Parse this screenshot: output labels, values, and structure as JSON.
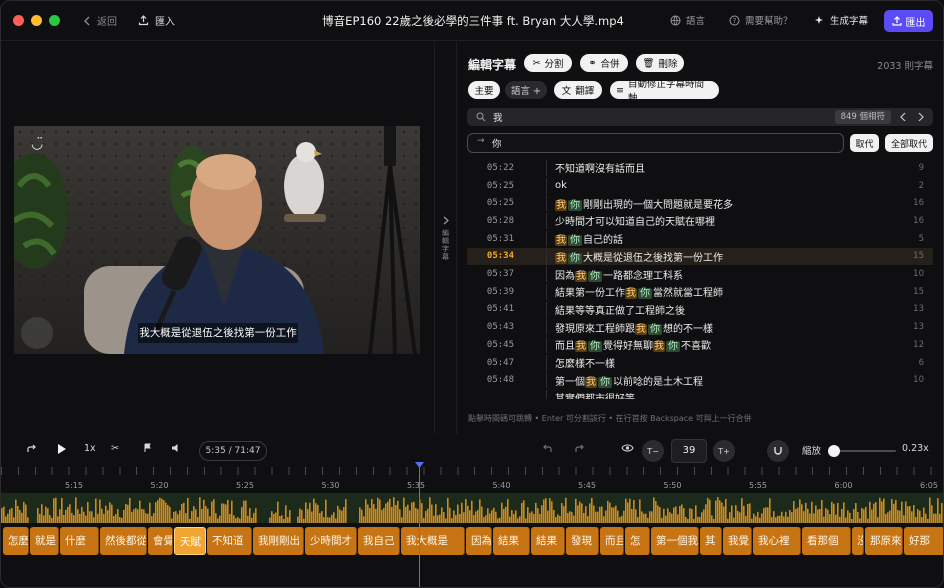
{
  "titlebar": {
    "back": "返回",
    "import": "匯入",
    "title": "博音EP160 22歲之後必學的三件事 ft. Bryan 大人學.mp4",
    "language": "語言",
    "help": "需要幫助？",
    "generate": "生成字幕",
    "export": "匯出"
  },
  "video": {
    "subtitle": "我大概是從退伍之後找第一份工作"
  },
  "collapse": {
    "label": "編輯字幕"
  },
  "editor": {
    "title": "編輯字幕",
    "split": "分割",
    "merge": "合併",
    "delete": "刪除",
    "count": "2033 則字幕",
    "main": "主要",
    "language": "語言 +",
    "translate": "翻譯",
    "auto_fix": "自動修正字幕時間軸",
    "search_value": "我",
    "match_count": "849 個相符",
    "replace_value": "你",
    "replace": "取代",
    "replace_all": "全部取代",
    "hint": "點擊時間碼可跳轉 • Enter 可分割該行 • 在行首按 Backspace 可與上一行合併",
    "rows": [
      {
        "time": "05:22",
        "segments": [
          {
            "t": "不知道啊沒有話而且",
            "k": "p"
          }
        ],
        "n": "9"
      },
      {
        "time": "05:25",
        "segments": [
          {
            "t": "ok",
            "k": "p"
          }
        ],
        "n": "2"
      },
      {
        "time": "05:25",
        "segments": [
          {
            "t": "我",
            "k": "w"
          },
          {
            "t": "你",
            "k": "n"
          },
          {
            "t": "剛剛出現的一個大問題就是要花多",
            "k": "p"
          }
        ],
        "n": "16"
      },
      {
        "time": "05:28",
        "segments": [
          {
            "t": "少時間才可以知道自己的天賦在哪裡",
            "k": "p"
          }
        ],
        "n": "16"
      },
      {
        "time": "05:31",
        "segments": [
          {
            "t": "我",
            "k": "w"
          },
          {
            "t": "你",
            "k": "n"
          },
          {
            "t": "自己的話",
            "k": "p"
          }
        ],
        "n": "5"
      },
      {
        "time": "05:34",
        "segments": [
          {
            "t": "我",
            "k": "w"
          },
          {
            "t": "你",
            "k": "n"
          },
          {
            "t": "大概是從退伍之後找第一份工作",
            "k": "p"
          }
        ],
        "n": "15",
        "active": true
      },
      {
        "time": "05:37",
        "segments": [
          {
            "t": "因為",
            "k": "p"
          },
          {
            "t": "我",
            "k": "w"
          },
          {
            "t": "你",
            "k": "n"
          },
          {
            "t": "一路都念理工科系",
            "k": "p"
          }
        ],
        "n": "10"
      },
      {
        "time": "05:39",
        "segments": [
          {
            "t": "結果第一份工作",
            "k": "p"
          },
          {
            "t": "我",
            "k": "w"
          },
          {
            "t": "你",
            "k": "n"
          },
          {
            "t": "當然就當工程師",
            "k": "p"
          }
        ],
        "n": "15"
      },
      {
        "time": "05:41",
        "segments": [
          {
            "t": "結果等等真正做了工程師之後",
            "k": "p"
          }
        ],
        "n": "13"
      },
      {
        "time": "05:43",
        "segments": [
          {
            "t": "發現原來工程師跟",
            "k": "p"
          },
          {
            "t": "我",
            "k": "w"
          },
          {
            "t": "你",
            "k": "n"
          },
          {
            "t": "想的不一樣",
            "k": "p"
          }
        ],
        "n": "13"
      },
      {
        "time": "05:45",
        "segments": [
          {
            "t": "而且",
            "k": "p"
          },
          {
            "t": "我",
            "k": "w"
          },
          {
            "t": "你",
            "k": "n"
          },
          {
            "t": "覺得好無聊",
            "k": "p"
          },
          {
            "t": "我",
            "k": "w"
          },
          {
            "t": "你",
            "k": "n"
          },
          {
            "t": "不喜歡",
            "k": "p"
          }
        ],
        "n": "12"
      },
      {
        "time": "05:47",
        "segments": [
          {
            "t": "怎麼樣不一樣",
            "k": "p"
          }
        ],
        "n": "6"
      },
      {
        "time": "05:48",
        "segments": [
          {
            "t": "第一個",
            "k": "p"
          },
          {
            "t": "我",
            "k": "w"
          },
          {
            "t": "你",
            "k": "n"
          },
          {
            "t": "以前唸的是土木工程",
            "k": "p"
          }
        ],
        "n": "10"
      },
      {
        "time": "",
        "segments": [
          {
            "t": "其實們都市很好等",
            "k": "p"
          }
        ],
        "n": ""
      }
    ]
  },
  "controls": {
    "speed": "1x",
    "time": "5:35 / 71:47",
    "font_minus": "T−",
    "font_size": "39",
    "font_plus": "T+",
    "zoom_label": "縮放",
    "zoom_value": "0.23x",
    "zoom_level": 0.05
  },
  "timeline": {
    "ticks": [
      "5:15",
      "5:20",
      "5:25",
      "5:30",
      "5:35",
      "5:40",
      "5:45",
      "5:50",
      "5:55",
      "6:00",
      "6:05"
    ],
    "clips": [
      {
        "label": "怎麼"
      },
      {
        "label": "就是"
      },
      {
        "label": "什麼"
      },
      {
        "label": "然後都從"
      },
      {
        "label": "會覺"
      },
      {
        "label": "天賦",
        "selected": true
      },
      {
        "label": "不知道"
      },
      {
        "label": "我剛剛出"
      },
      {
        "label": "少時間才"
      },
      {
        "label": "我自己"
      },
      {
        "label": "我大概是"
      },
      {
        "label": "因為"
      },
      {
        "label": "結果"
      },
      {
        "label": "結果"
      },
      {
        "label": "發現"
      },
      {
        "label": "而且"
      },
      {
        "label": "怎"
      },
      {
        "label": "第一個我"
      },
      {
        "label": "其"
      },
      {
        "label": "我覺"
      },
      {
        "label": "我心裡"
      },
      {
        "label": "看那個"
      },
      {
        "label": "沒"
      },
      {
        "label": "那原來"
      },
      {
        "label": "好那"
      }
    ]
  },
  "colors": {
    "accent": "#5b4bf5",
    "highlight_match": "#5b3d12",
    "highlight_replace": "#2c4a34",
    "clip": "#c77414",
    "waveform": "#d08a1c"
  }
}
